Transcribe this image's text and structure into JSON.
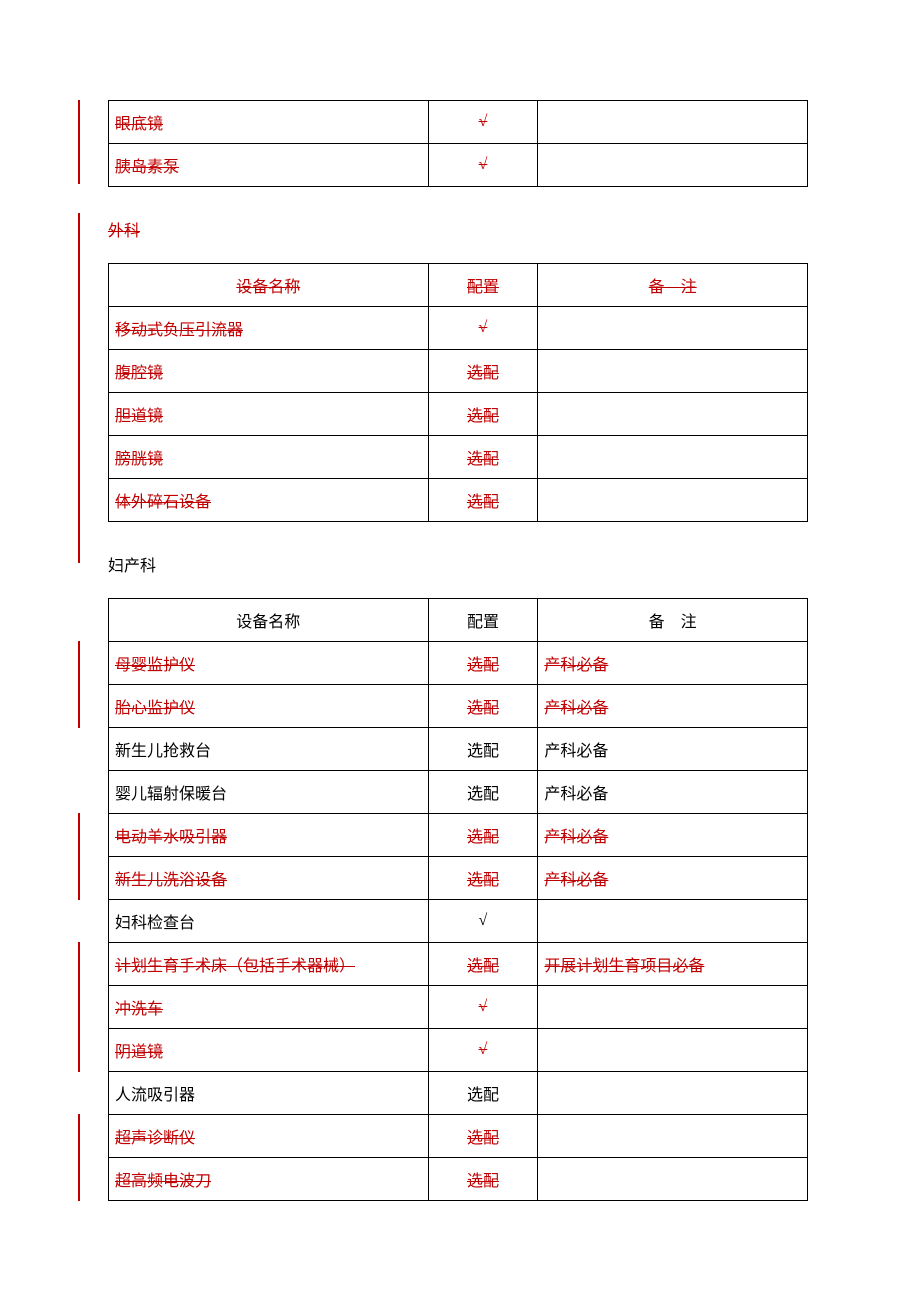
{
  "table1": {
    "rows": [
      {
        "name": "眼底镜",
        "config": "√",
        "note": "",
        "struck": true
      },
      {
        "name": "胰岛素泵",
        "config": "√",
        "note": "",
        "struck": true
      }
    ]
  },
  "section2": {
    "title": "外科",
    "struck": true,
    "header_name": "设备名称",
    "header_config": "配置",
    "header_note": "备　注",
    "rows": [
      {
        "name": "移动式负压引流器",
        "config": "√",
        "note": "",
        "struck": true
      },
      {
        "name": "腹腔镜",
        "config": "选配",
        "note": "",
        "struck": true
      },
      {
        "name": "胆道镜",
        "config": "选配",
        "note": "",
        "struck": true
      },
      {
        "name": "膀胱镜",
        "config": "选配",
        "note": "",
        "struck": true
      },
      {
        "name": "体外碎石设备",
        "config": "选配",
        "note": "",
        "struck": true
      }
    ]
  },
  "section3": {
    "title": "妇产科",
    "struck": false,
    "header_name": "设备名称",
    "header_config": "配置",
    "header_note": "备　注",
    "rows": [
      {
        "name": "母婴监护仪",
        "config": "选配",
        "note": "产科必备",
        "struck": true
      },
      {
        "name": "胎心监护仪",
        "config": "选配",
        "note": "产科必备",
        "struck": true
      },
      {
        "name": "新生儿抢救台",
        "config": "选配",
        "note": "产科必备",
        "struck": false
      },
      {
        "name": "婴儿辐射保暖台",
        "config": "选配",
        "note": "产科必备",
        "struck": false
      },
      {
        "name": "电动羊水吸引器",
        "config": "选配",
        "note": "产科必备",
        "struck": true
      },
      {
        "name": "新生儿洗浴设备",
        "config": "选配",
        "note": "产科必备",
        "struck": true
      },
      {
        "name": "妇科检查台",
        "config": "√",
        "note": "",
        "struck": false
      },
      {
        "name": "计划生育手术床（包括手术器械）",
        "config": "选配",
        "note": "开展计划生育项目必备",
        "struck": true
      },
      {
        "name": "冲洗车",
        "config": "√",
        "note": "",
        "struck": true
      },
      {
        "name": "阴道镜",
        "config": "√",
        "note": "",
        "struck": true
      },
      {
        "name": "人流吸引器",
        "config": "选配",
        "note": "",
        "struck": false
      },
      {
        "name": "超声诊断仪",
        "config": "选配",
        "note": "",
        "struck": true
      },
      {
        "name": "超高频电波刀",
        "config": "选配",
        "note": "",
        "ck_note_struck": false,
        "struck": true
      }
    ]
  }
}
